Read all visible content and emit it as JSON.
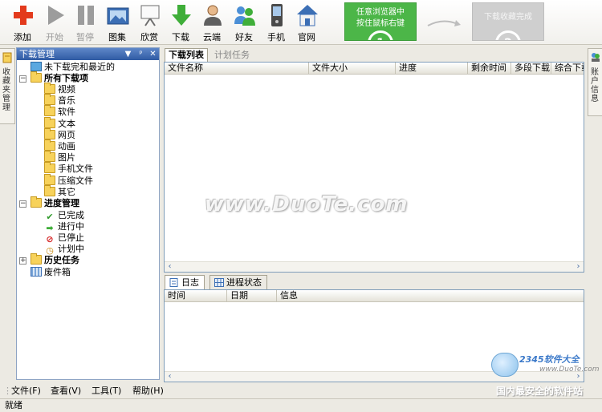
{
  "toolbar": {
    "buttons": [
      {
        "label": "添加",
        "icon": "add-icon",
        "enabled": true
      },
      {
        "label": "开始",
        "icon": "play-icon",
        "enabled": false
      },
      {
        "label": "暂停",
        "icon": "pause-icon",
        "enabled": false
      },
      {
        "label": "图集",
        "icon": "gallery-icon",
        "enabled": true
      },
      {
        "label": "欣赏",
        "icon": "presentation-icon",
        "enabled": true
      },
      {
        "label": "下载",
        "icon": "download-icon",
        "enabled": true
      },
      {
        "label": "云端",
        "icon": "cloud-user-icon",
        "enabled": true
      },
      {
        "label": "好友",
        "icon": "friends-icon",
        "enabled": true
      },
      {
        "label": "手机",
        "icon": "phone-icon",
        "enabled": true
      },
      {
        "label": "官网",
        "icon": "home-icon",
        "enabled": true
      }
    ],
    "hint_step1": {
      "line1": "任意浏览器中",
      "line2": "按住鼠标右键",
      "num": "1"
    },
    "hint_step2": {
      "text": "下载收藏完成",
      "num": "2"
    }
  },
  "left_vtab": "收藏夹管理",
  "right_vtab": "账户信息",
  "panel": {
    "title": "下载管理",
    "controls": [
      "▼",
      "ᵖ",
      "✕"
    ],
    "tree": {
      "recent": "未下载完和最近的",
      "all_downloads": "所有下载项",
      "categories": [
        "视频",
        "音乐",
        "软件",
        "文本",
        "网页",
        "动画",
        "图片",
        "手机文件",
        "压缩文件",
        "其它"
      ],
      "progress_mgmt": "进度管理",
      "progress_items": [
        "已完成",
        "进行中",
        "已停止",
        "计划中"
      ],
      "history": "历史任务",
      "trash": "废件箱"
    }
  },
  "top_tabs": [
    "下载列表",
    "计划任务"
  ],
  "list_columns": [
    "文件名称",
    "文件大小",
    "进度",
    "剩余时间",
    "多段下载",
    "综合下载"
  ],
  "bottom_tabs": [
    "日志",
    "进程状态"
  ],
  "log_columns": [
    "时间",
    "日期",
    "信息"
  ],
  "watermark": {
    "main": "www.DuoTe.com",
    "logo": "2345软件大全",
    "url": "www.DuoTe.com"
  },
  "menus": [
    "文件(F)",
    "查看(V)",
    "工具(T)",
    "帮助(H)"
  ],
  "slogan": "国内最安全的软件站",
  "status": "就绪",
  "colors": {
    "accent": "#2f5aa3",
    "hint_green": "#4cb648"
  }
}
